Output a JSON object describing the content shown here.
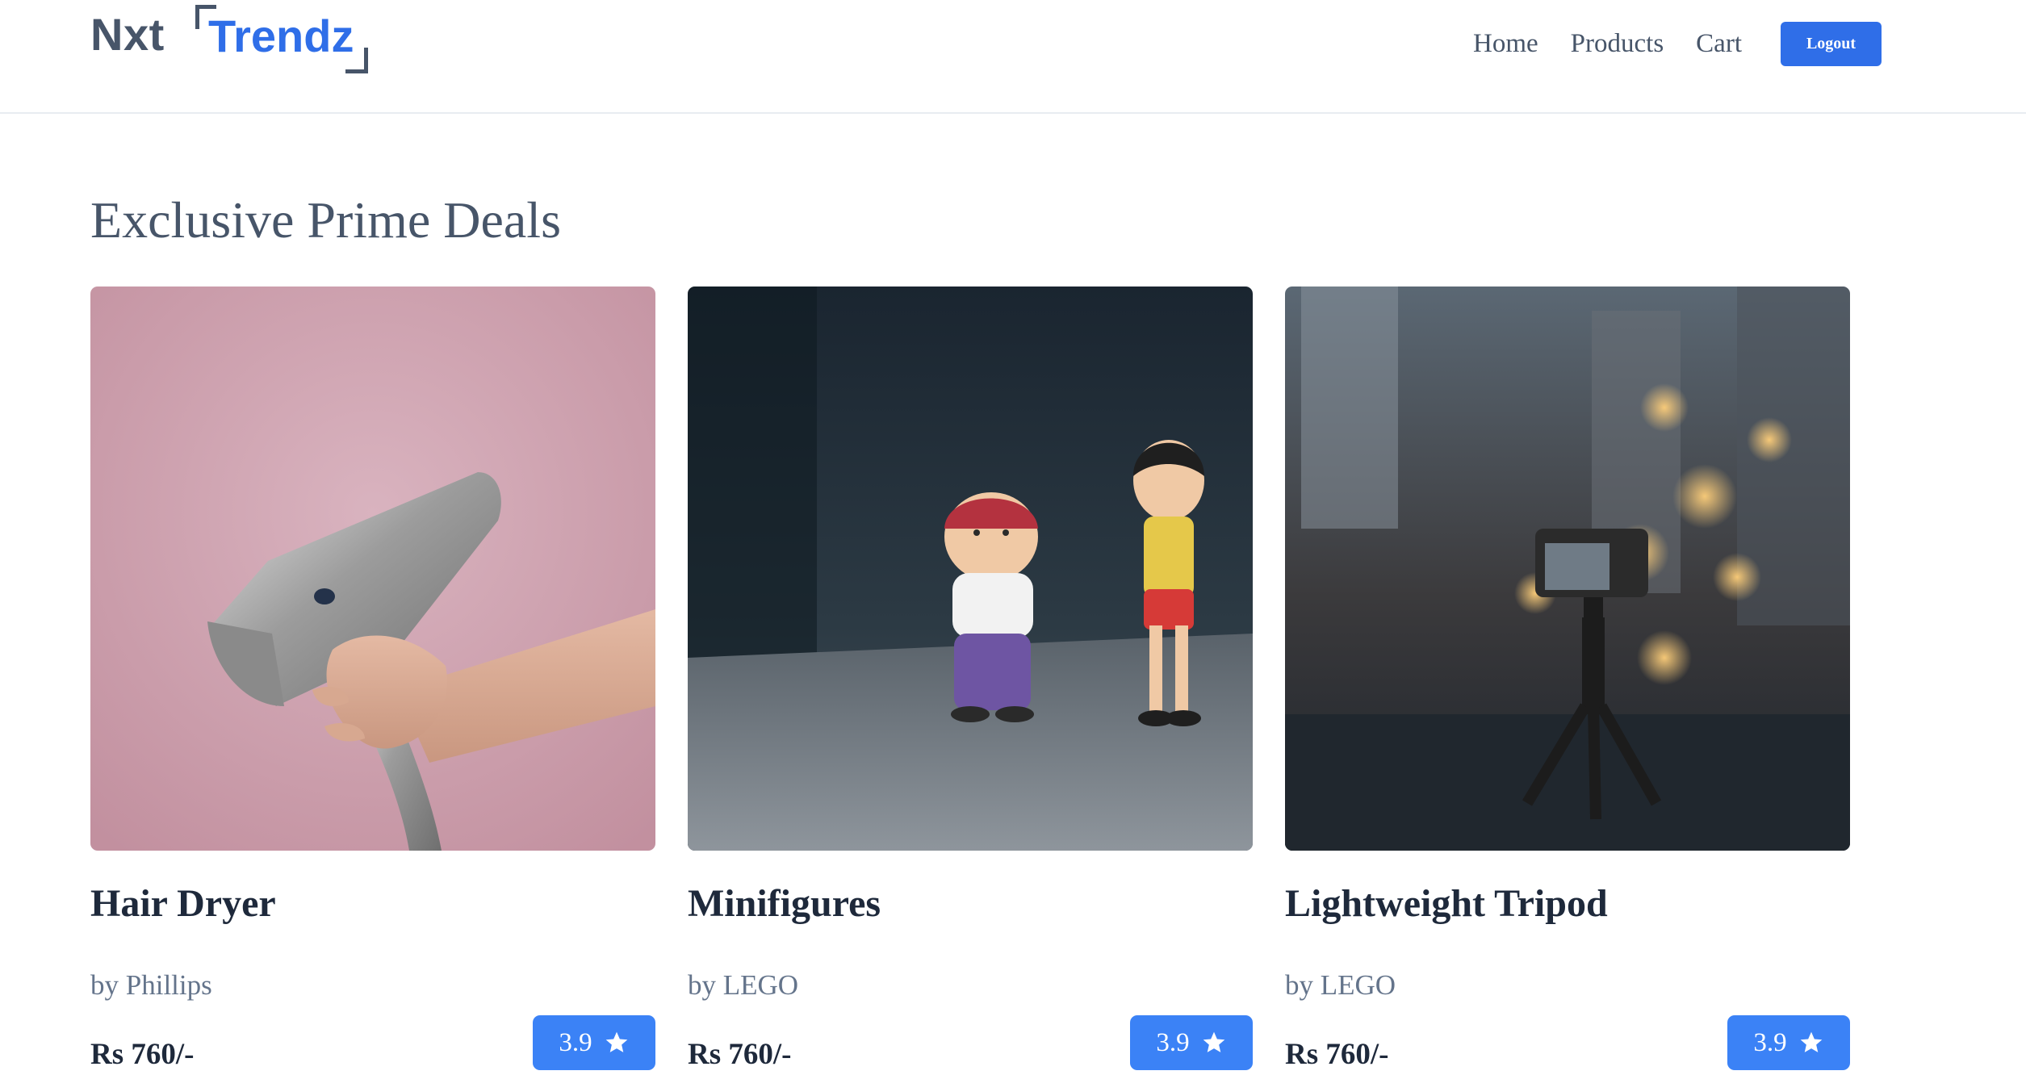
{
  "header": {
    "logo": {
      "part1": "Nxt",
      "part2": "Trendz"
    },
    "nav": [
      "Home",
      "Products",
      "Cart"
    ],
    "logout_label": "Logout"
  },
  "section": {
    "title": "Exclusive Prime Deals"
  },
  "products": [
    {
      "title": "Hair Dryer",
      "brand": "by Phillips",
      "price": "Rs 760/-",
      "rating": "3.9",
      "image": "hair-dryer-photo"
    },
    {
      "title": "Minifigures",
      "brand": "by LEGO",
      "price": "Rs 760/-",
      "rating": "3.9",
      "image": "minifigures-photo"
    },
    {
      "title": "Lightweight Tripod",
      "brand": "by LEGO",
      "price": "Rs 760/-",
      "rating": "3.9",
      "image": "tripod-photo"
    }
  ],
  "colors": {
    "brand_blue": "#2f6ee8",
    "rating_blue": "#3b82f6",
    "text_slate": "#475569"
  }
}
